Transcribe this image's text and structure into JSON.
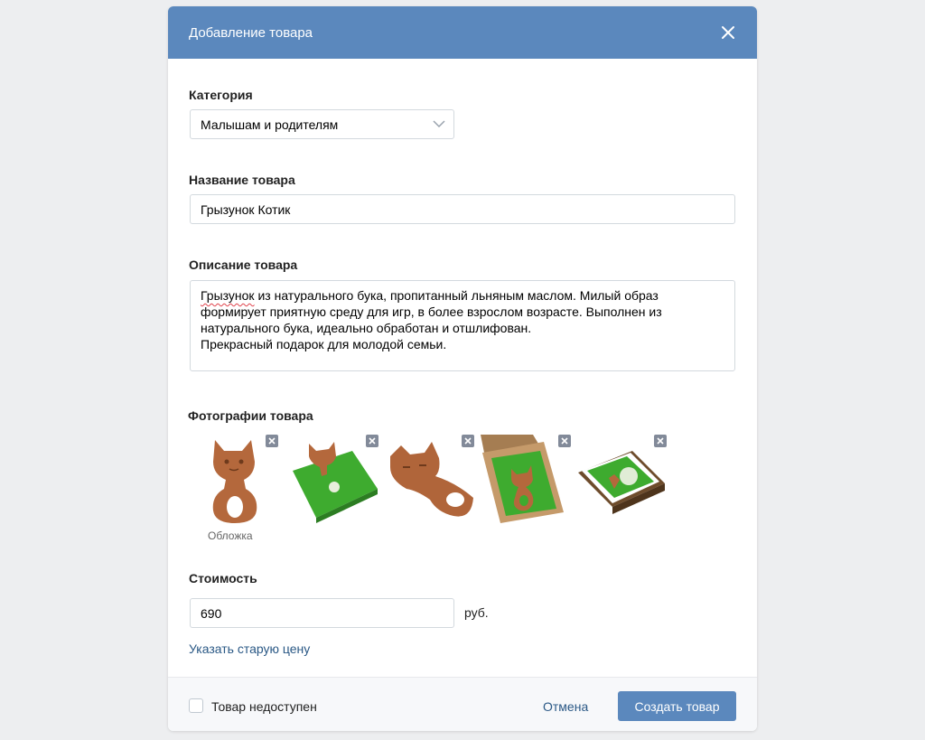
{
  "modal": {
    "title": "Добавление товара"
  },
  "category": {
    "label": "Категория",
    "value": "Малышам и родителям"
  },
  "name": {
    "label": "Название товара",
    "value": "Грызунок Котик"
  },
  "description": {
    "label": "Описание товара",
    "misspelled_word": "Грызунок",
    "lines": [
      " из натурального бука, пропитанный льняным маслом. Милый образ",
      "формирует приятную среду для игр, в более взрослом возрасте. Выполнен из",
      "натурального бука, идеально обработан и отшлифован.",
      "Прекрасный подарок для молодой семьи."
    ]
  },
  "photos": {
    "label": "Фотографии товара",
    "cover_label": "Обложка",
    "items": [
      "photo-cat-teether",
      "photo-teether-on-green-box",
      "photo-cat-teether-angle",
      "photo-teether-in-box",
      "photo-packaging-box"
    ]
  },
  "price": {
    "label": "Стоимость",
    "value": "690",
    "currency": "руб.",
    "old_price_link": "Указать старую цену"
  },
  "footer": {
    "unavailable_label": "Товар недоступен",
    "cancel_label": "Отмена",
    "submit_label": "Создать товар"
  },
  "colors": {
    "header": "#5b88bd",
    "link": "#2a5885",
    "wood": "#b4683c",
    "green": "#4caf3a"
  }
}
